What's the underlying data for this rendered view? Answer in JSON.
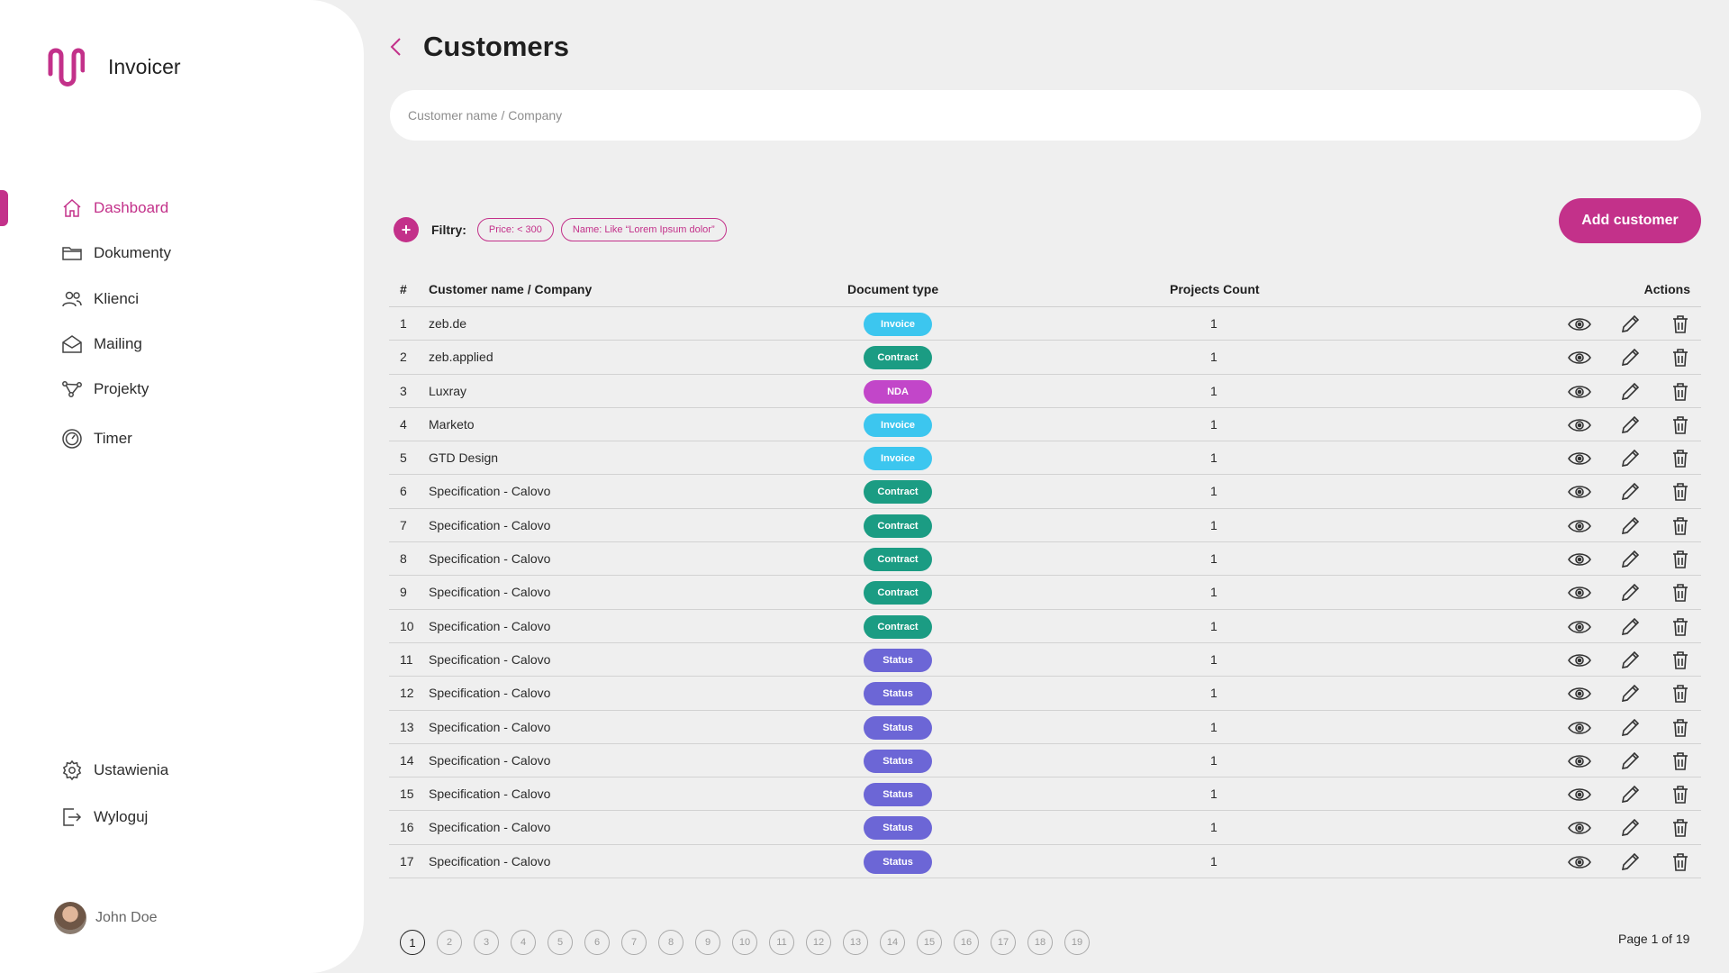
{
  "app": {
    "name": "Invoicer"
  },
  "colors": {
    "accent": "#c3318a",
    "invoice": "#3cc6ef",
    "contract": "#1b9c83",
    "nda": "#c246c9",
    "status": "#6c66d6"
  },
  "sidebar": {
    "items": [
      {
        "label": "Dashboard",
        "icon": "home-icon",
        "active": true
      },
      {
        "label": "Dokumenty",
        "icon": "folder-icon"
      },
      {
        "label": "Klienci",
        "icon": "users-icon"
      },
      {
        "label": "Mailing",
        "icon": "mail-icon"
      },
      {
        "label": "Projekty",
        "icon": "nodes-icon"
      },
      {
        "label": "Timer",
        "icon": "timer-icon"
      }
    ],
    "bottom": [
      {
        "label": "Ustawienia",
        "icon": "gear-icon"
      },
      {
        "label": "Wyloguj",
        "icon": "logout-icon"
      }
    ],
    "user": {
      "name": "John Doe"
    }
  },
  "header": {
    "title": "Customers"
  },
  "search": {
    "placeholder": "Customer name / Company",
    "value": ""
  },
  "filters": {
    "label": "Filtry:",
    "chips": [
      "Price: < 300",
      "Name: Like “Lorem Ipsum dolor”"
    ]
  },
  "add_button": "Add customer",
  "table": {
    "headers": {
      "num": "#",
      "name": "Customer name / Company",
      "doc": "Document type",
      "count": "Projects Count",
      "actions": "Actions"
    },
    "rows": [
      {
        "num": "1",
        "name": "zeb.de",
        "doc": "Invoice",
        "count": "1"
      },
      {
        "num": "2",
        "name": "zeb.applied",
        "doc": "Contract",
        "count": "1"
      },
      {
        "num": "3",
        "name": "Luxray",
        "doc": "NDA",
        "count": "1"
      },
      {
        "num": "4",
        "name": "Marketo",
        "doc": "Invoice",
        "count": "1"
      },
      {
        "num": "5",
        "name": "GTD Design",
        "doc": "Invoice",
        "count": "1"
      },
      {
        "num": "6",
        "name": "Specification - Calovo",
        "doc": "Contract",
        "count": "1"
      },
      {
        "num": "7",
        "name": "Specification - Calovo",
        "doc": "Contract",
        "count": "1"
      },
      {
        "num": "8",
        "name": "Specification - Calovo",
        "doc": "Contract",
        "count": "1"
      },
      {
        "num": "9",
        "name": "Specification - Calovo",
        "doc": "Contract",
        "count": "1"
      },
      {
        "num": "10",
        "name": "Specification - Calovo",
        "doc": "Contract",
        "count": "1"
      },
      {
        "num": "11",
        "name": "Specification - Calovo",
        "doc": "Status",
        "count": "1"
      },
      {
        "num": "12",
        "name": "Specification - Calovo",
        "doc": "Status",
        "count": "1"
      },
      {
        "num": "13",
        "name": "Specification - Calovo",
        "doc": "Status",
        "count": "1"
      },
      {
        "num": "14",
        "name": "Specification - Calovo",
        "doc": "Status",
        "count": "1"
      },
      {
        "num": "15",
        "name": "Specification - Calovo",
        "doc": "Status",
        "count": "1"
      },
      {
        "num": "16",
        "name": "Specification - Calovo",
        "doc": "Status",
        "count": "1"
      },
      {
        "num": "17",
        "name": "Specification - Calovo",
        "doc": "Status",
        "count": "1"
      }
    ]
  },
  "pagination": {
    "pages": [
      "1",
      "2",
      "3",
      "4",
      "5",
      "6",
      "7",
      "8",
      "9",
      "10",
      "11",
      "12",
      "13",
      "14",
      "15",
      "16",
      "17",
      "18",
      "19"
    ],
    "current": "1",
    "info": "Page 1 of 19"
  }
}
